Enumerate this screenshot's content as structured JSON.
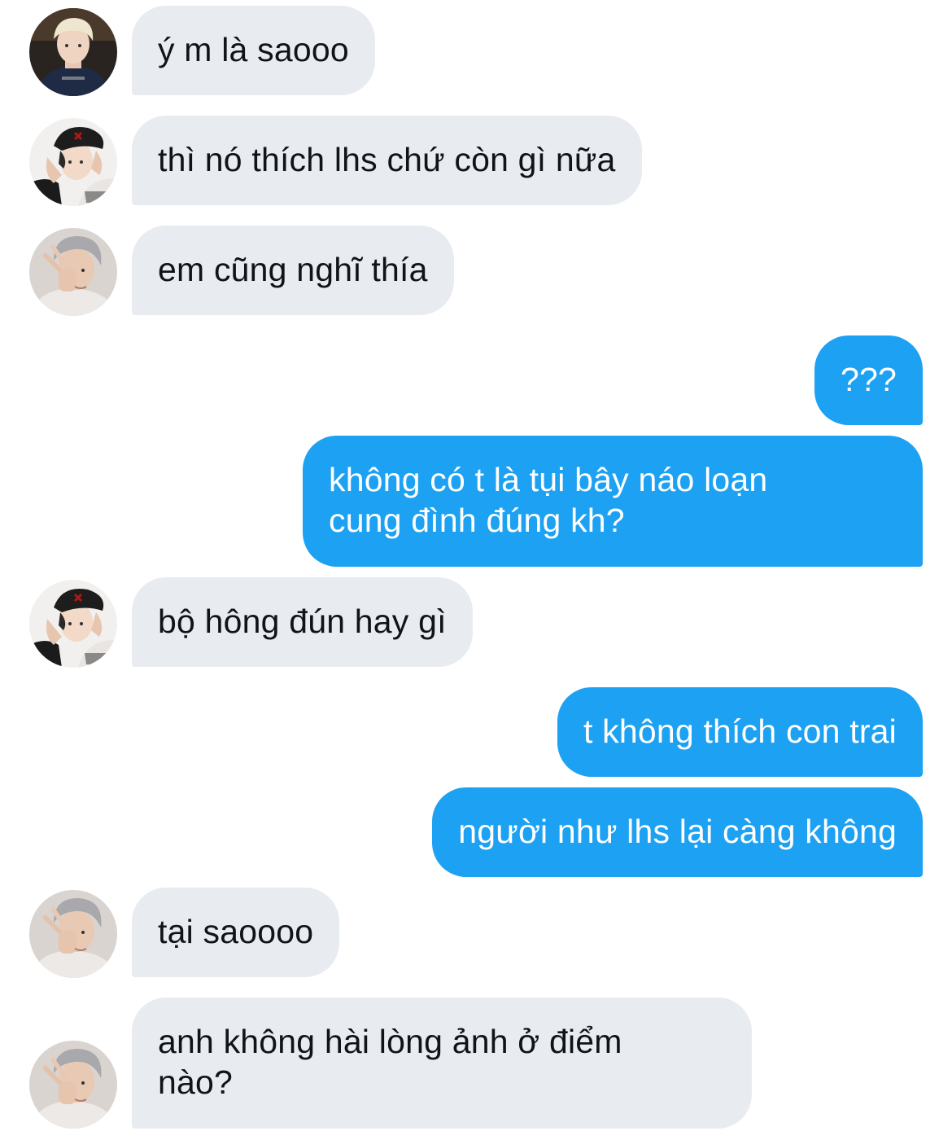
{
  "colors": {
    "incoming_bubble": "#e8ecf0",
    "outgoing_bubble": "#1da1f2",
    "incoming_text": "#0f1419",
    "outgoing_text": "#ffffff",
    "background": "#ffffff"
  },
  "messages": [
    {
      "direction": "incoming",
      "avatar": "avatar-blond-person",
      "lines": [
        "ý m là saooo"
      ]
    },
    {
      "direction": "incoming",
      "avatar": "avatar-cap-person",
      "lines": [
        "thì nó thích lhs chứ còn gì nữa"
      ]
    },
    {
      "direction": "incoming",
      "avatar": "avatar-gray-hair-person",
      "lines": [
        "em cũng nghĩ thía"
      ]
    },
    {
      "direction": "outgoing",
      "lines": [
        "???"
      ]
    },
    {
      "direction": "outgoing",
      "lines": [
        "không có t là tụi bây náo loạn",
        "cung đình đúng kh?"
      ]
    },
    {
      "direction": "incoming",
      "avatar": "avatar-cap-person",
      "lines": [
        "bộ hông đún hay gì"
      ]
    },
    {
      "direction": "outgoing",
      "lines": [
        "t không thích con trai"
      ]
    },
    {
      "direction": "outgoing",
      "lines": [
        "người như lhs lại càng không"
      ]
    },
    {
      "direction": "incoming",
      "avatar": "avatar-gray-hair-person",
      "lines": [
        "tại saoooo"
      ]
    },
    {
      "direction": "incoming",
      "avatar": "avatar-gray-hair-person",
      "lines": [
        "anh không hài lòng ảnh ở điểm",
        "nào?"
      ]
    }
  ]
}
